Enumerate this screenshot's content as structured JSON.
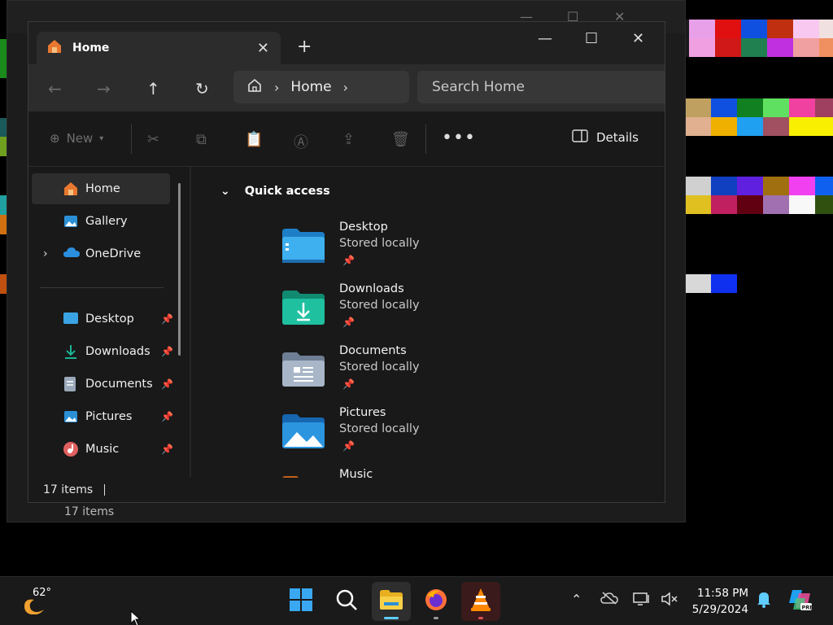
{
  "background_window": {
    "status": "17 items"
  },
  "explorer": {
    "tab": {
      "label": "Home"
    },
    "address": {
      "crumb": "Home"
    },
    "search": {
      "placeholder": "Search Home"
    },
    "commands": {
      "new_label": "New",
      "details_label": "Details"
    },
    "sidebar": {
      "items": [
        {
          "label": "Home",
          "icon": "home-icon"
        },
        {
          "label": "Gallery",
          "icon": "gallery-icon"
        },
        {
          "label": "OneDrive",
          "icon": "onedrive-icon"
        }
      ],
      "pinned": [
        {
          "label": "Desktop",
          "icon": "desktop-folder-icon"
        },
        {
          "label": "Downloads",
          "icon": "downloads-icon"
        },
        {
          "label": "Documents",
          "icon": "documents-icon"
        },
        {
          "label": "Pictures",
          "icon": "pictures-icon"
        },
        {
          "label": "Music",
          "icon": "music-icon"
        }
      ]
    },
    "quick_access": {
      "header": "Quick access",
      "items": [
        {
          "name": "Desktop",
          "sub": "Stored locally",
          "color": "#3aa3e3"
        },
        {
          "name": "Downloads",
          "sub": "Stored locally",
          "color": "#1bb394"
        },
        {
          "name": "Documents",
          "sub": "Stored locally",
          "color": "#8e9fb6"
        },
        {
          "name": "Pictures",
          "sub": "Stored locally",
          "color": "#2b8fd6"
        },
        {
          "name": "Music",
          "sub": "",
          "color": "#e0772a"
        }
      ]
    },
    "status": "17 items"
  },
  "taskbar": {
    "weather_temp": "62°",
    "time": "11:58 PM",
    "date": "5/29/2024"
  },
  "colors": {
    "accent": "#60cdff",
    "window_bg": "#191919"
  }
}
